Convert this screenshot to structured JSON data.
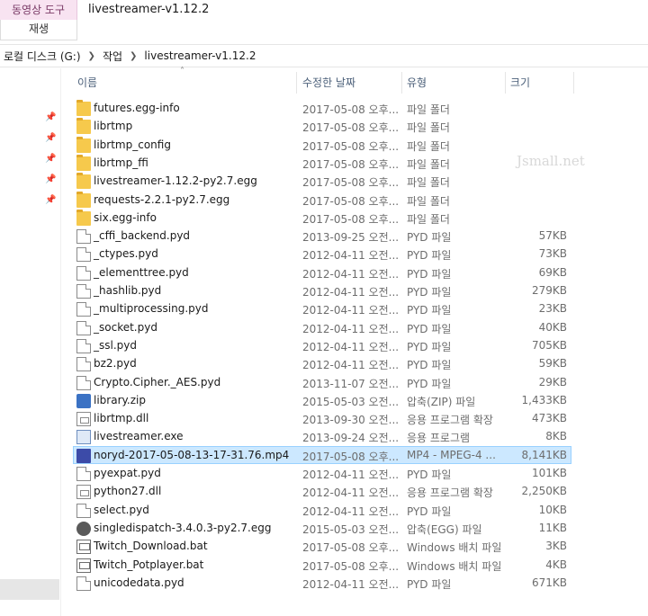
{
  "ribbon": {
    "tool_tab": "동영상 도구",
    "play_tab": "재생",
    "window_title": "livestreamer-v1.12.2"
  },
  "address": {
    "crumbs": [
      "로컬 디스크 (G:)",
      "작업",
      "livestreamer-v1.12.2"
    ]
  },
  "columns": {
    "name": "이름",
    "date": "수정한 날짜",
    "type": "유형",
    "size": "크기"
  },
  "watermark": "Jsmall.net",
  "files": [
    {
      "name": "futures.egg-info",
      "date": "2017-05-08 오후...",
      "type": "파일 폴더",
      "size": "",
      "icon": "folder-icon"
    },
    {
      "name": "librtmp",
      "date": "2017-05-08 오후...",
      "type": "파일 폴더",
      "size": "",
      "icon": "folder-icon"
    },
    {
      "name": "librtmp_config",
      "date": "2017-05-08 오후...",
      "type": "파일 폴더",
      "size": "",
      "icon": "folder-icon"
    },
    {
      "name": "librtmp_ffi",
      "date": "2017-05-08 오후...",
      "type": "파일 폴더",
      "size": "",
      "icon": "folder-icon"
    },
    {
      "name": "livestreamer-1.12.2-py2.7.egg",
      "date": "2017-05-08 오후...",
      "type": "파일 폴더",
      "size": "",
      "icon": "folder-icon"
    },
    {
      "name": "requests-2.2.1-py2.7.egg",
      "date": "2017-05-08 오후...",
      "type": "파일 폴더",
      "size": "",
      "icon": "folder-icon"
    },
    {
      "name": "six.egg-info",
      "date": "2017-05-08 오후...",
      "type": "파일 폴더",
      "size": "",
      "icon": "folder-icon"
    },
    {
      "name": "_cffi_backend.pyd",
      "date": "2013-09-25 오전...",
      "type": "PYD 파일",
      "size": "57KB",
      "icon": "file-icon"
    },
    {
      "name": "_ctypes.pyd",
      "date": "2012-04-11 오전...",
      "type": "PYD 파일",
      "size": "73KB",
      "icon": "file-icon"
    },
    {
      "name": "_elementtree.pyd",
      "date": "2012-04-11 오전...",
      "type": "PYD 파일",
      "size": "69KB",
      "icon": "file-icon"
    },
    {
      "name": "_hashlib.pyd",
      "date": "2012-04-11 오전...",
      "type": "PYD 파일",
      "size": "279KB",
      "icon": "file-icon"
    },
    {
      "name": "_multiprocessing.pyd",
      "date": "2012-04-11 오전...",
      "type": "PYD 파일",
      "size": "23KB",
      "icon": "file-icon"
    },
    {
      "name": "_socket.pyd",
      "date": "2012-04-11 오전...",
      "type": "PYD 파일",
      "size": "40KB",
      "icon": "file-icon"
    },
    {
      "name": "_ssl.pyd",
      "date": "2012-04-11 오전...",
      "type": "PYD 파일",
      "size": "705KB",
      "icon": "file-icon"
    },
    {
      "name": "bz2.pyd",
      "date": "2012-04-11 오전...",
      "type": "PYD 파일",
      "size": "59KB",
      "icon": "file-icon"
    },
    {
      "name": "Crypto.Cipher._AES.pyd",
      "date": "2013-11-07 오전...",
      "type": "PYD 파일",
      "size": "29KB",
      "icon": "file-icon"
    },
    {
      "name": "library.zip",
      "date": "2015-05-03 오전...",
      "type": "압축(ZIP) 파일",
      "size": "1,433KB",
      "icon": "zip-icon"
    },
    {
      "name": "librtmp.dll",
      "date": "2013-09-30 오전...",
      "type": "응용 프로그램 확장",
      "size": "473KB",
      "icon": "dll-icon"
    },
    {
      "name": "livestreamer.exe",
      "date": "2013-09-24 오전...",
      "type": "응용 프로그램",
      "size": "8KB",
      "icon": "exe-icon"
    },
    {
      "name": "noryd-2017-05-08-13-17-31.76.mp4",
      "date": "2017-05-08 오후...",
      "type": "MP4 - MPEG-4 ...",
      "size": "8,141KB",
      "icon": "mp4-icon",
      "selected": true
    },
    {
      "name": "pyexpat.pyd",
      "date": "2012-04-11 오전...",
      "type": "PYD 파일",
      "size": "101KB",
      "icon": "file-icon"
    },
    {
      "name": "python27.dll",
      "date": "2012-04-11 오전...",
      "type": "응용 프로그램 확장",
      "size": "2,250KB",
      "icon": "dll-icon"
    },
    {
      "name": "select.pyd",
      "date": "2012-04-11 오전...",
      "type": "PYD 파일",
      "size": "10KB",
      "icon": "file-icon"
    },
    {
      "name": "singledispatch-3.4.0.3-py2.7.egg",
      "date": "2015-05-03 오전...",
      "type": "압축(EGG) 파일",
      "size": "11KB",
      "icon": "egg-icon"
    },
    {
      "name": "Twitch_Download.bat",
      "date": "2017-05-08 오후...",
      "type": "Windows 배치 파일",
      "size": "3KB",
      "icon": "bat-icon"
    },
    {
      "name": "Twitch_Potplayer.bat",
      "date": "2017-05-08 오후...",
      "type": "Windows 배치 파일",
      "size": "4KB",
      "icon": "bat-icon"
    },
    {
      "name": "unicodedata.pyd",
      "date": "2012-04-11 오전...",
      "type": "PYD 파일",
      "size": "671KB",
      "icon": "file-icon"
    }
  ]
}
